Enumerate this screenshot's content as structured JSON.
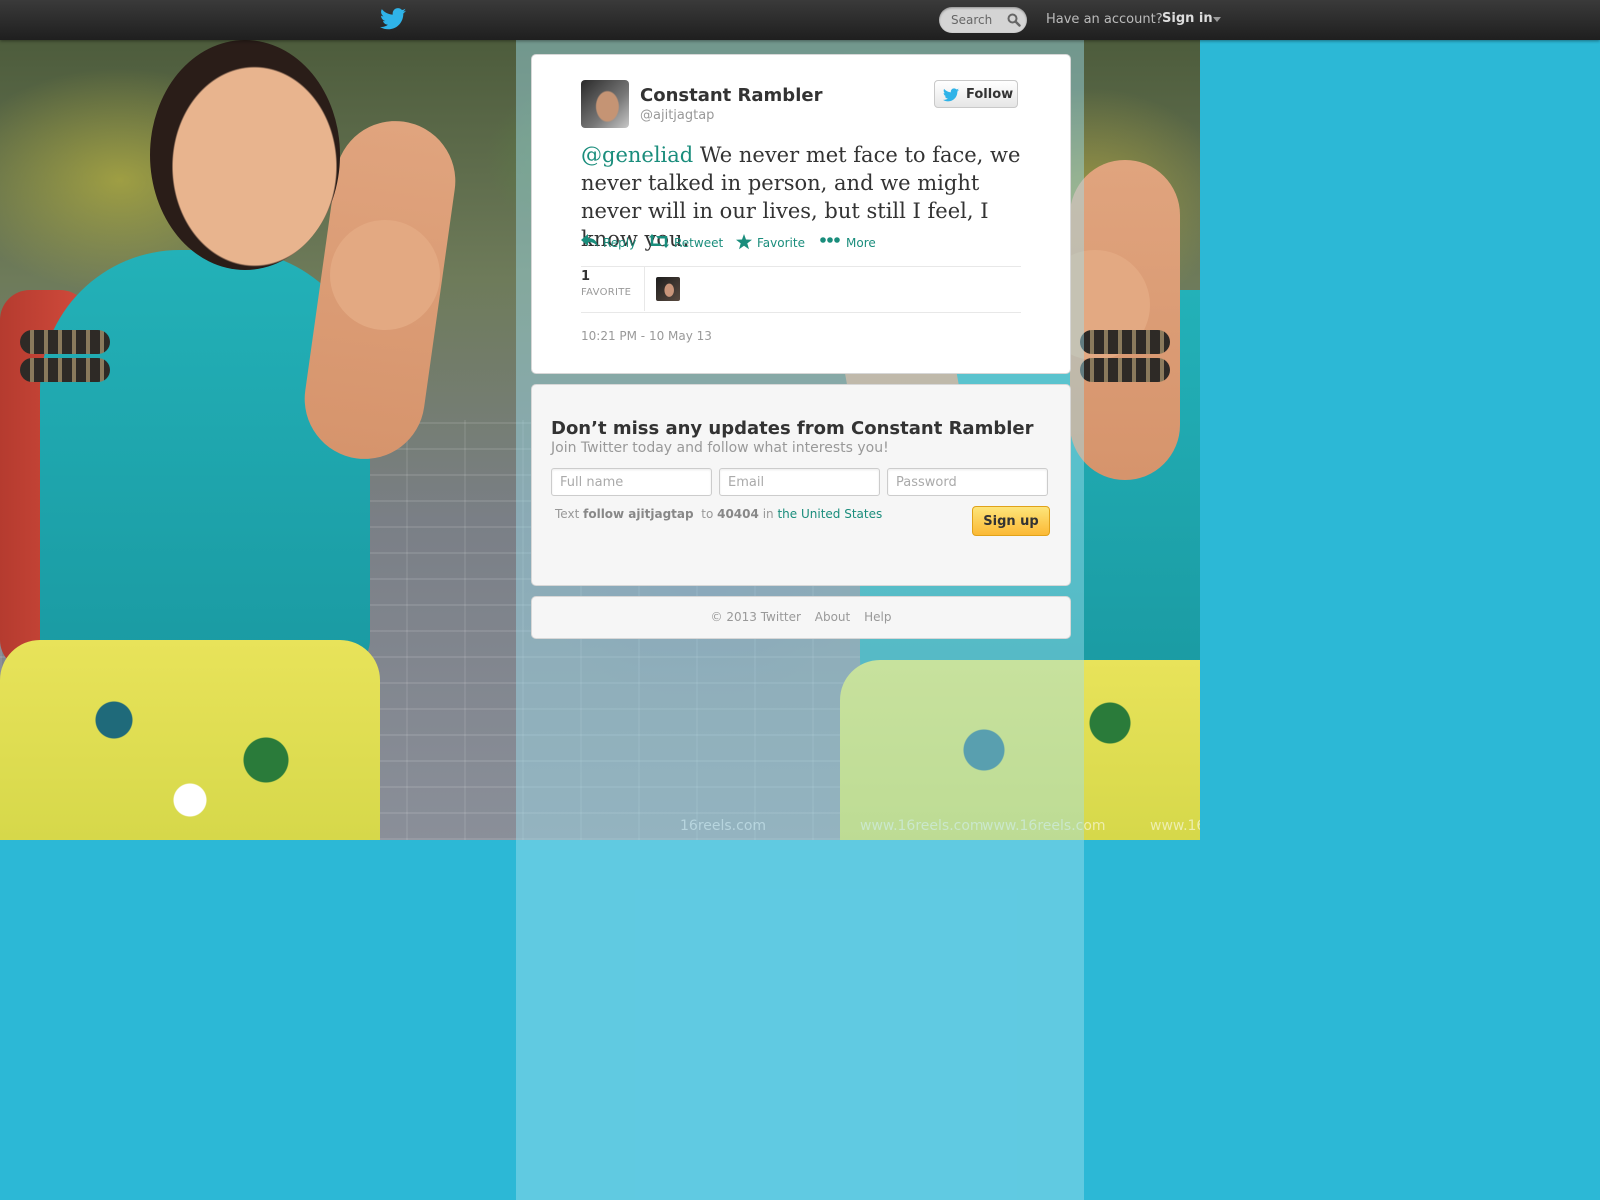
{
  "colors": {
    "page_background": "#2cb8d6",
    "link": "#1a8d7c",
    "topbar": "#2a2a2a",
    "signup_button": "#fbb935"
  },
  "topbar": {
    "logo_icon": "twitter-bird-icon",
    "search_placeholder": "Search",
    "search_icon": "magnifier-icon",
    "account_prompt": "Have an account?",
    "signin_label": "Sign in",
    "signin_caret_icon": "caret-down-icon"
  },
  "background_photo": {
    "watermarks": [
      "16reels.com",
      "www.16reels.com",
      "www.16reels.com",
      "www.16"
    ]
  },
  "tweet": {
    "display_name": "Constant Rambler",
    "screen_name": "@ajitjagtap",
    "follow_label": "Follow",
    "mention": "@geneliad",
    "text": " We never met face to face, we never talked in person, and we might never will in our lives, but still I feel, I know you.",
    "actions": {
      "reply": "Reply",
      "retweet": "Retweet",
      "favorite": "Favorite",
      "more": "More"
    },
    "favorite_count": "1",
    "favorite_label": "FAVORITE",
    "timestamp": "10:21 PM - 10 May 13"
  },
  "signup": {
    "title": "Don’t miss any updates from Constant Rambler",
    "subtitle": "Join Twitter today and follow what interests you!",
    "fullname_placeholder": "Full name",
    "email_placeholder": "Email",
    "password_placeholder": "Password",
    "sms_text_prefix": "Text",
    "sms_command": "follow ajitjagtap",
    "sms_to": "to",
    "sms_shortcode": "40404",
    "sms_in": "in",
    "sms_country": "the United States",
    "button_label": "Sign up"
  },
  "footer": {
    "copyright": "© 2013 Twitter",
    "about": "About",
    "help": "Help"
  }
}
